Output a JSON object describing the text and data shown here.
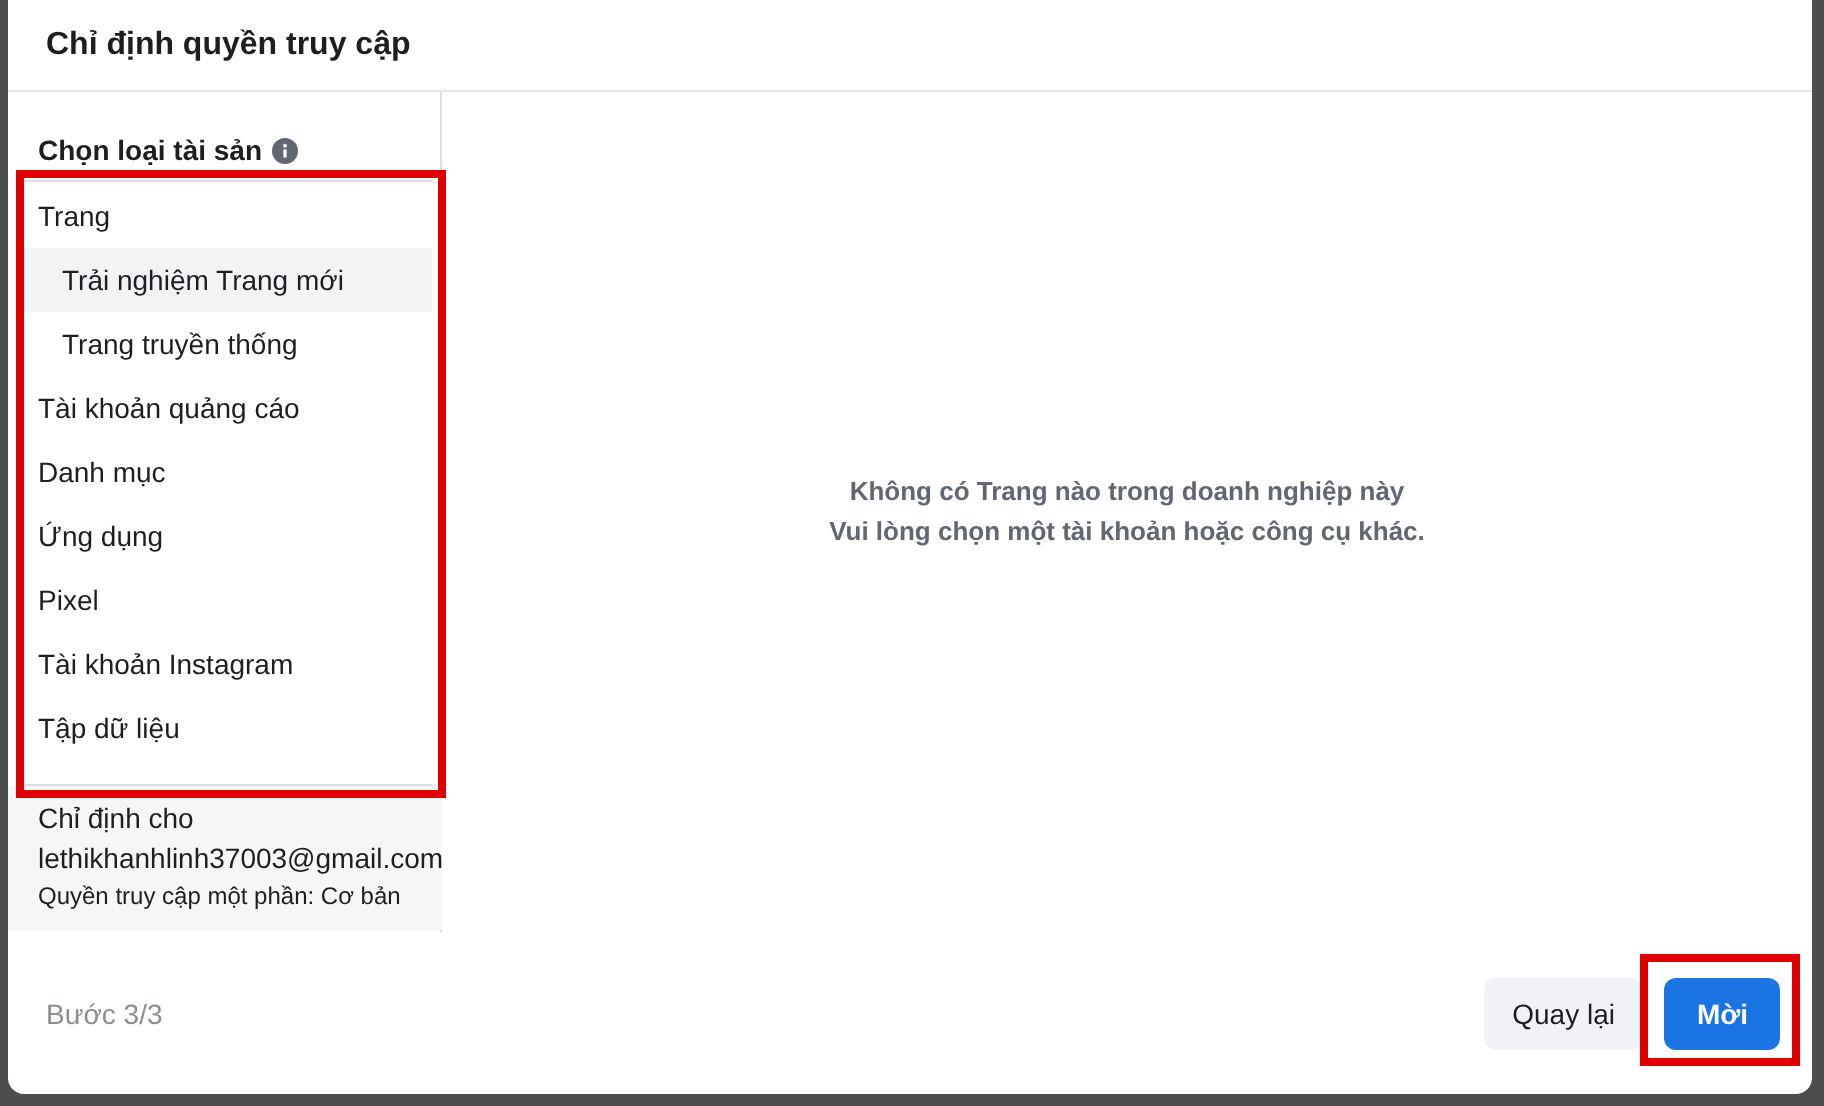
{
  "dialog": {
    "title": "Chỉ định quyền truy cập"
  },
  "asset_panel": {
    "heading": "Chọn loại tài sản",
    "highlighted": true,
    "asset_types": [
      {
        "label": "Trang",
        "selected": false,
        "children": [
          {
            "label": "Trải nghiệm Trang mới",
            "selected": true
          },
          {
            "label": "Trang truyền thống",
            "selected": false
          }
        ]
      },
      {
        "label": "Tài khoản quảng cáo",
        "selected": false
      },
      {
        "label": "Danh mục",
        "selected": false
      },
      {
        "label": "Ứng dụng",
        "selected": false
      },
      {
        "label": "Pixel",
        "selected": false
      },
      {
        "label": "Tài khoản Instagram",
        "selected": false
      },
      {
        "label": "Tập dữ liệu",
        "selected": false
      }
    ]
  },
  "assignee": {
    "label": "Chỉ định cho",
    "email": "lethikhanhlinh37003@gmail.com",
    "access": "Quyền truy cập một phần: Cơ bản"
  },
  "empty_message": [
    "Không có Trang nào trong doanh nghiệp này",
    "Vui lòng chọn một tài khoản hoặc công cụ khác."
  ],
  "footer": {
    "step": "Bước 3/3",
    "buttons": [
      {
        "label": "Quay lại",
        "kind": "secondary",
        "highlighted": false
      },
      {
        "label": "Mời",
        "kind": "primary",
        "highlighted": true
      }
    ]
  }
}
